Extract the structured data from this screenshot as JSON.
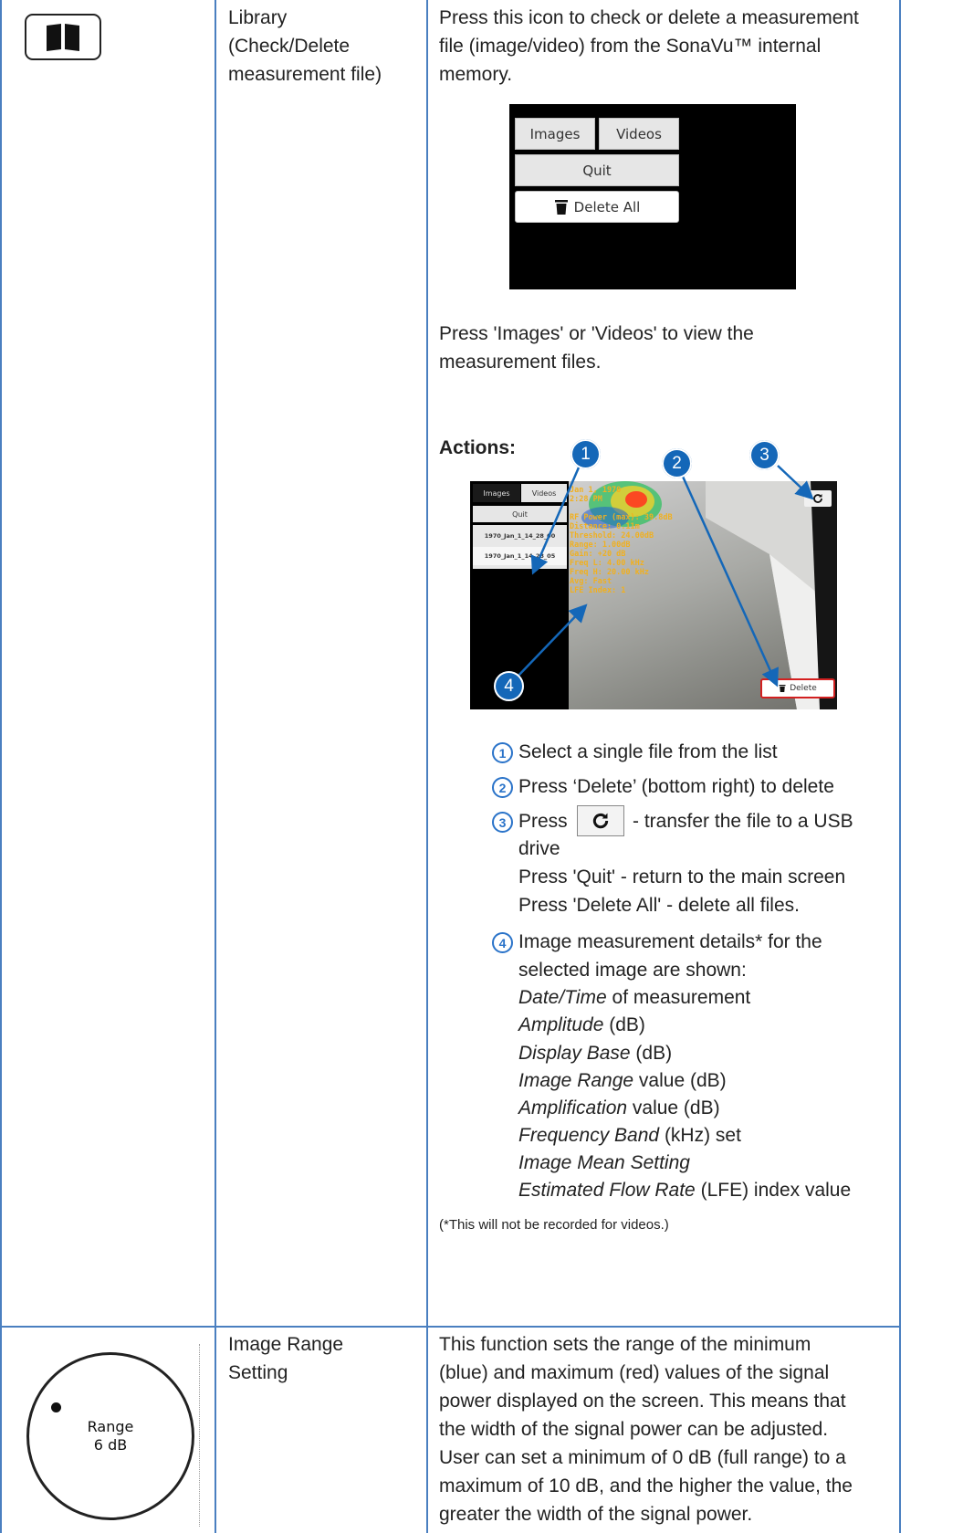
{
  "row1": {
    "name_line1": "Library",
    "name_line2": "(Check/Delete",
    "name_line3": "measurement file)",
    "desc_line1": "Press this icon to check or delete a measurement",
    "desc_line2": "file (image/video) from the SonaVu™ internal",
    "desc_line3": "memory.",
    "menu": {
      "images": "Images",
      "videos": "Videos",
      "quit": "Quit",
      "delete_all": "Delete All"
    },
    "press_line1": "Press 'Images' or 'Videos' to view the",
    "press_line2": "measurement files.",
    "actions_label": "Actions:",
    "shot": {
      "images": "Images",
      "videos": "Videos",
      "quit": "Quit",
      "file1": "1970_Jan_1_14_28_00",
      "file2": "1970_Jan_1_14_28_05",
      "overlay": [
        "Jan 1, 1970",
        "2:28 PM",
        "",
        "RF Power (max): 39.8dB",
        "Distance: 0.11m",
        "Threshold: 24.00dB",
        "Range: 1.00dB",
        "Gain: +20 dB",
        "Freq L: 4.00 kHz",
        "Freq H: 20.00 kHz",
        "Avg: Fast",
        "LFE Index: 1"
      ],
      "delete": "Delete"
    },
    "callouts": [
      "1",
      "2",
      "3",
      "4"
    ],
    "steps": {
      "s1": "Select a single file from the list",
      "s2": "Press ‘Delete’ (bottom right) to delete",
      "s3_pre": "Press",
      "s3_post": "- transfer the file to a USB",
      "s3_cont": "drive",
      "s3_quit": "Press 'Quit' - return to the main screen",
      "s3_delall": "Press 'Delete All' - delete all files.",
      "s4_line1": "Image measurement details* for the",
      "s4_line2": "selected image are shown:",
      "details": [
        {
          "it": "Date/Time",
          "rest": " of measurement"
        },
        {
          "it": "Amplitude",
          "rest": " (dB)"
        },
        {
          "it": "Display Base",
          "rest": " (dB)"
        },
        {
          "it": "Image Range",
          "rest": " value (dB)"
        },
        {
          "it": "Amplification",
          "rest": " value (dB)"
        },
        {
          "it": "Frequency Band",
          "rest": " (kHz) set"
        },
        {
          "it": "Image Mean Setting",
          "rest": ""
        },
        {
          "it": "Estimated Flow Rate",
          "rest": " (LFE) index value"
        }
      ],
      "footnote": "(*This will not be recorded for videos.)"
    }
  },
  "row2": {
    "dial_line1": "Range",
    "dial_line2": "6 dB",
    "name_line1": "Image Range",
    "name_line2": "Setting",
    "desc": [
      "This function sets the range of the minimum",
      "(blue) and maximum (red) values of the signal",
      "power displayed on the screen. This means that",
      "the width of the signal power can be adjusted.",
      "User can set a minimum of 0 dB (full range) to a",
      "maximum of 10 dB, and the higher the value, the",
      "greater the width of the signal power."
    ]
  }
}
